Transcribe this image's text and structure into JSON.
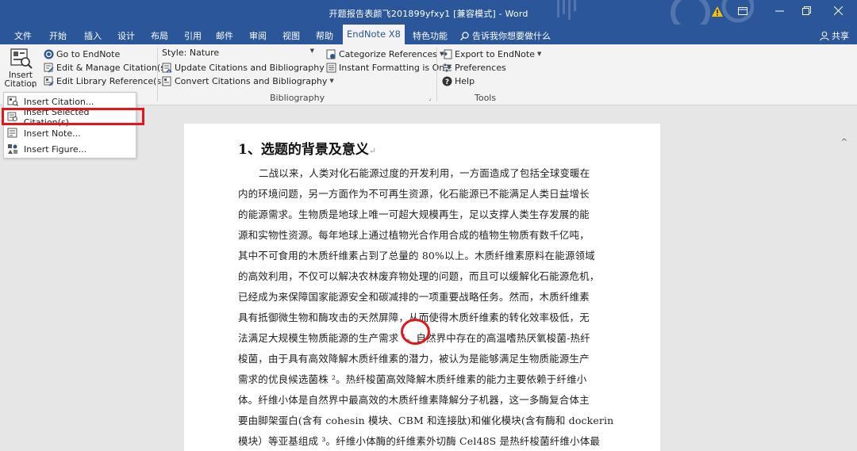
{
  "window": {
    "title": "开题报告表颜飞201899yfxy1 [兼容模式] - Word",
    "controls": [
      "warning-icon",
      "ribbon-display-icon",
      "minimize-icon",
      "restore-icon",
      "close-icon"
    ]
  },
  "menu": {
    "tabs": [
      "文件",
      "开始",
      "插入",
      "设计",
      "布局",
      "引用",
      "邮件",
      "审阅",
      "视图",
      "帮助",
      "EndNote X8",
      "特色功能"
    ],
    "active_tab": "EndNote X8",
    "tell_me": "告诉我你想要做什么",
    "share": "共享"
  },
  "ribbon": {
    "insert_citation": "Insert Citation",
    "citations": {
      "go_to_endnote": "Go to EndNote",
      "edit_manage": "Edit & Manage Citation(s)",
      "edit_library": "Edit Library Reference(s)"
    },
    "bibliography": {
      "style_label": "Style:",
      "style_value": "Nature",
      "update": "Update Citations and Bibliography",
      "convert": "Convert Citations and Bibliography",
      "categorize": "Categorize References",
      "instant_formatting": "Instant Formatting is On",
      "group_label": "Bibliography"
    },
    "tools": {
      "export": "Export to EndNote",
      "preferences": "Preferences",
      "help": "Help",
      "group_label": "Tools"
    }
  },
  "dropdown": {
    "items": [
      "Insert Citation...",
      "Insert Selected Citation(s)",
      "Insert Note...",
      "Insert Figure..."
    ],
    "highlighted_index": 1
  },
  "document": {
    "heading": "1、选题的背景及意义",
    "lines": [
      "二战以来，人类对化石能源过度的开发利用，一方面造成了包括全球变暖在",
      "内的环境问题，另一方面作为不可再生资源，化石能源已不能满足人类日益增长",
      "的能源需求。生物质是地球上唯一可超大规模再生，足以支撑人类生存发展的能",
      "源和实物性资源。每年地球上通过植物光合作用合成的植物生物质有数千亿吨，",
      "其中不可食用的木质纤维素占到了总量的 80%以上。木质纤维素原料在能源领域",
      "的高效利用，不仅可以解决农林废弃物处理的问题，而且可以缓解化石能源危机，",
      "已经成为来保障国家能源安全和碳减排的一项重要战略任务。然而，木质纤维素",
      "具有抵御微生物和酶攻击的天然屏障，从而使得木质纤维素的转化效率极低，无",
      "法满足大规模生物质能源的生产需求 ¹。自然界中存在的高温嗜热厌氧梭菌-热纤",
      "梭菌，由于具有高效降解木质纤维素的潜力，被认为是能够满足生物质能源生产",
      "需求的优良候选菌株 ²。热纤梭菌高效降解木质纤维素的能力主要依赖于纤维小",
      "体。纤维小体是自然界中最高效的木质纤维素降解分子机器，这一多酶复合体主",
      "要由脚架蛋白(含有 cohesin 模块、CBM 和连接肽)和催化模块(含有酶和 dockerin",
      "模块）等亚基组成 ³。纤维小体酶的纤维素外切酶 Cel48S 是热纤梭菌纤维小体最"
    ]
  },
  "colors": {
    "title_bar": "#2b579a",
    "ribbon_bg": "#f3f3f3",
    "highlight_red": "#e4161b",
    "workspace": "#e6e6e6"
  }
}
